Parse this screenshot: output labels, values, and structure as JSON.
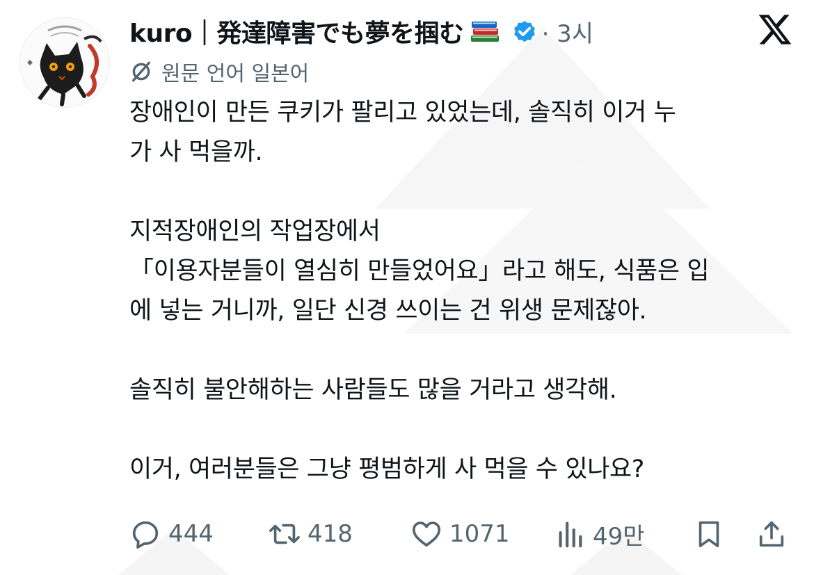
{
  "author": {
    "display_name": "kuro｜発達障害でも夢を掴む",
    "emoji_icon": "books-icon",
    "verified_color": "#1d9bf0",
    "time": "· 3시"
  },
  "translation": {
    "label": "원문 언어 일본어"
  },
  "post": {
    "lines": [
      "장애인이 만든 쿠키가 팔리고 있었는데, 솔직히 이거 누",
      "가 사 먹을까.",
      "",
      "지적장애인의 작업장에서",
      "「이용자분들이 열심히 만들었어요」라고 해도, 식품은 입",
      "에 넣는 거니까, 일단 신경 쓰이는 건 위생 문제잖아.",
      "",
      "솔직히 불안해하는 사람들도 많을 거라고 생각해.",
      "",
      "이거, 여러분들은 그냥 평범하게 사 먹을 수 있나요?"
    ]
  },
  "actions": {
    "replies": "444",
    "reposts": "418",
    "likes": "1071",
    "views": "49만"
  },
  "colors": {
    "text": "#0f1419",
    "secondary": "#536471",
    "watermark": "#f2f2f2"
  }
}
